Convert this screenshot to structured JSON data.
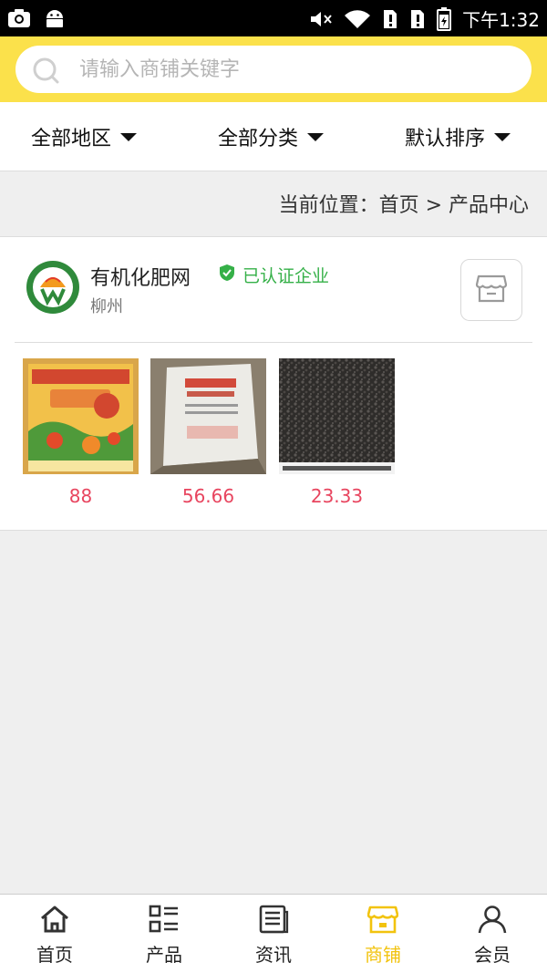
{
  "status_bar": {
    "time": "下午1:32",
    "icons": [
      "screenshot-icon",
      "android-icon",
      "mute-icon",
      "wifi-icon",
      "sim1-icon",
      "sim2-icon",
      "battery-icon"
    ]
  },
  "search": {
    "placeholder": "请输入商铺关键字",
    "value": ""
  },
  "filters": [
    {
      "label": "全部地区"
    },
    {
      "label": "全部分类"
    },
    {
      "label": "默认排序"
    }
  ],
  "breadcrumb": "当前位置：首页 > 产品中心",
  "shop": {
    "name": "有机化肥网",
    "badge": "已认证企业",
    "city": "柳州",
    "logo_icon": "organic-logo-icon",
    "store_icon": "store-icon"
  },
  "products": [
    {
      "price": "88",
      "image": "fertilizer-bag-yellow"
    },
    {
      "price": "56.66",
      "image": "fertilizer-bag-white"
    },
    {
      "price": "23.33",
      "image": "fertilizer-granules"
    }
  ],
  "bottom_nav": [
    {
      "label": "首页",
      "icon": "home-icon",
      "active": false
    },
    {
      "label": "产品",
      "icon": "product-list-icon",
      "active": false
    },
    {
      "label": "资讯",
      "icon": "news-icon",
      "active": false
    },
    {
      "label": "商铺",
      "icon": "shop-icon",
      "active": true
    },
    {
      "label": "会员",
      "icon": "member-icon",
      "active": false
    }
  ],
  "colors": {
    "accent_yellow": "#fbe14b",
    "nav_active": "#f2c30e",
    "price_red": "#e8455f",
    "verified_green": "#35b048"
  }
}
